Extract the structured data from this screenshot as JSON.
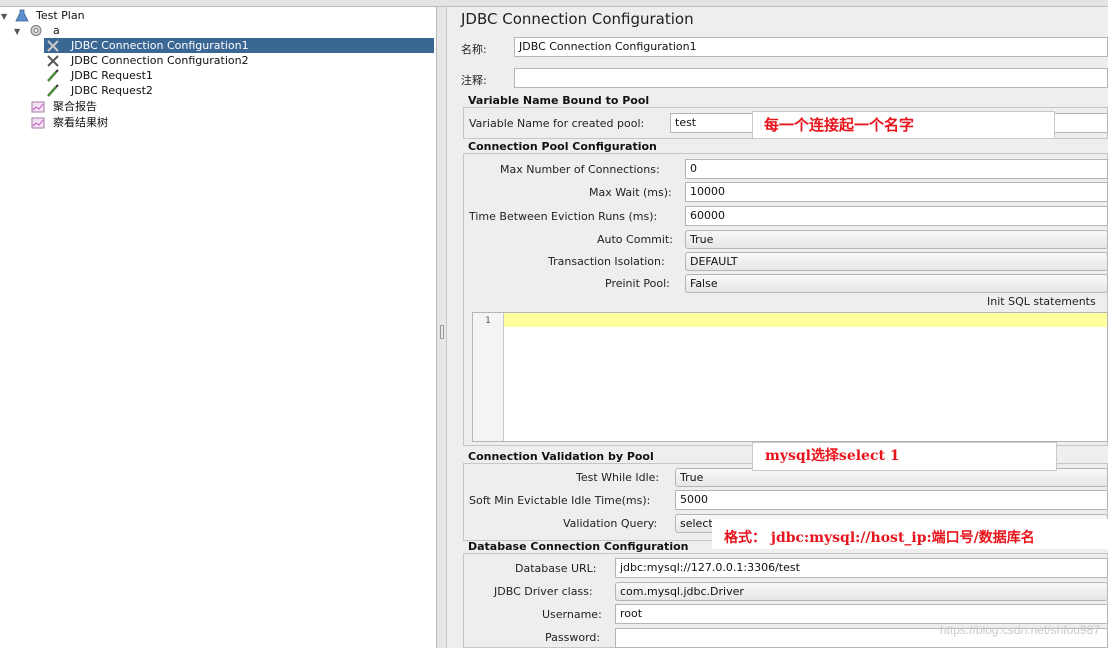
{
  "tree": {
    "items": [
      {
        "label": "Test Plan",
        "icon": "test-plan-flask-icon"
      },
      {
        "label": "a",
        "icon": "thread-group-gear-icon"
      },
      {
        "label": "JDBC Connection Configuration1",
        "icon": "jdbc-config-wrench-icon"
      },
      {
        "label": "JDBC Connection Configuration2",
        "icon": "jdbc-config-wrench-icon"
      },
      {
        "label": "JDBC Request1",
        "icon": "jdbc-request-pipette-icon"
      },
      {
        "label": "JDBC Request2",
        "icon": "jdbc-request-pipette-icon"
      },
      {
        "label": "聚合报告",
        "icon": "listener-report-icon"
      },
      {
        "label": "察看结果树",
        "icon": "listener-tree-icon"
      }
    ]
  },
  "panel": {
    "title": "JDBC Connection Configuration",
    "name_label": "名称:",
    "name_value": "JDBC Connection Configuration1",
    "comment_label": "注释:",
    "comment_value": "",
    "var_section": "Variable Name Bound to Pool",
    "var_label": "Variable Name for created pool:",
    "var_value": "test",
    "pool_section": "Connection Pool Configuration",
    "max_conn_label": "Max Number of Connections:",
    "max_conn_value": "0",
    "max_wait_label": "Max Wait (ms):",
    "max_wait_value": "10000",
    "eviction_label": "Time Between Eviction Runs (ms):",
    "eviction_value": "60000",
    "auto_commit_label": "Auto Commit:",
    "auto_commit_value": "True",
    "isolation_label": "Transaction Isolation:",
    "isolation_value": "DEFAULT",
    "preinit_label": "Preinit Pool:",
    "preinit_value": "False",
    "init_sql_label": "Init SQL statements",
    "editor_line_number": "1",
    "validation_section": "Connection Validation by Pool",
    "test_idle_label": "Test While Idle:",
    "test_idle_value": "True",
    "soft_min_label": "Soft Min Evictable Idle Time(ms):",
    "soft_min_value": "5000",
    "validation_query_label": "Validation Query:",
    "validation_query_value": "select 1",
    "db_section": "Database Connection Configuration",
    "db_url_label": "Database URL:",
    "db_url_value": "jdbc:mysql://127.0.0.1:3306/test",
    "driver_label": "JDBC Driver class:",
    "driver_value": "com.mysql.jdbc.Driver",
    "username_label": "Username:",
    "username_value": "root",
    "password_label": "Password:",
    "password_value": ""
  },
  "annotations": {
    "pool_name_note": "每一个连接起一个名字",
    "mysql_select_note": "mysql选择select 1",
    "url_format_note": "格式： jdbc:mysql://host_ip:端口号/数据库名"
  },
  "watermark": "https://blog.csdn.net/shfou987",
  "colors": {
    "selection": "#3a6794",
    "annotation_text": "#e8141c",
    "editor_current_line": "#ffff9e"
  }
}
